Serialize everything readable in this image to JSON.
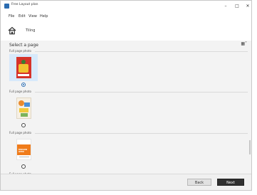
{
  "window": {
    "title": "Free Layout plan"
  },
  "menu": {
    "items": [
      "File",
      "Edit",
      "View",
      "Help"
    ]
  },
  "toolbar": {
    "tab_label": "Tiling"
  },
  "main": {
    "heading": "Select a page",
    "sections": [
      {
        "label": "Full page photo",
        "selected": true
      },
      {
        "label": "Full page photo",
        "selected": false
      },
      {
        "label": "Full page photo",
        "selected": false
      },
      {
        "label": "Full page photo",
        "selected": false
      }
    ],
    "thumb3_text": "MISSION OPEN"
  },
  "footer": {
    "back_label": "Back",
    "next_label": "Next"
  },
  "colors": {
    "accent": "#2b6cb0",
    "selected_bg": "#d7e9fb",
    "next_bg": "#2f2f2f"
  }
}
